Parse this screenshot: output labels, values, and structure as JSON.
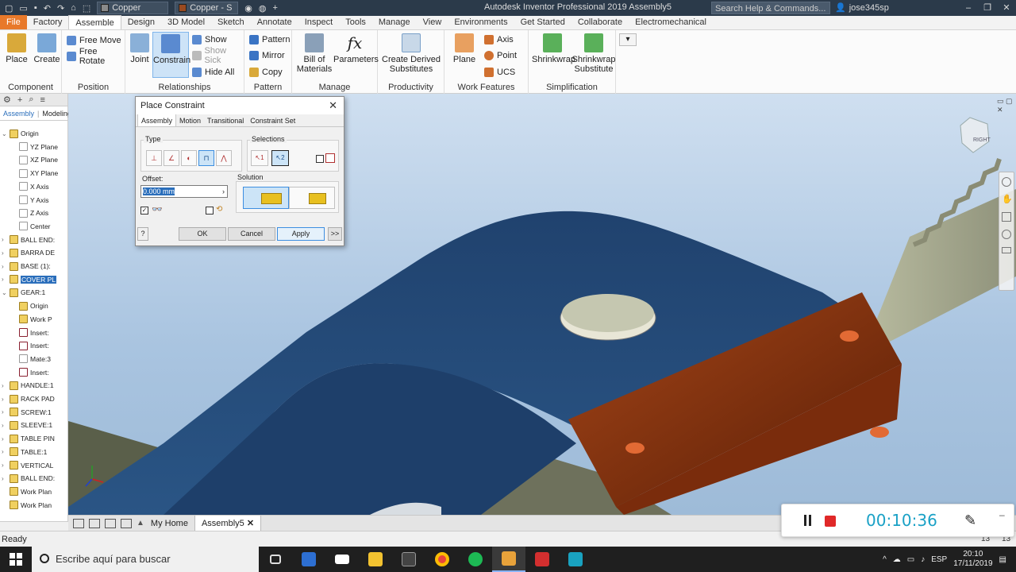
{
  "titlebar": {
    "material": "Copper",
    "appearance": "Copper - S",
    "window_title": "Autodesk Inventor Professional 2019    Assembly5",
    "search_placeholder": "Search Help & Commands...",
    "user": "jose345sp"
  },
  "tabs": [
    "File",
    "Factory",
    "Assemble",
    "Design",
    "3D Model",
    "Sketch",
    "Annotate",
    "Inspect",
    "Tools",
    "Manage",
    "View",
    "Environments",
    "Get Started",
    "Collaborate",
    "Electromechanical"
  ],
  "active_tab": "Assemble",
  "ribbon": {
    "component": {
      "label": "Component",
      "place": "Place",
      "create": "Create"
    },
    "position": {
      "label": "Position",
      "free_move": "Free Move",
      "free_rotate": "Free Rotate"
    },
    "relationships": {
      "label": "Relationships",
      "joint": "Joint",
      "constrain": "Constrain",
      "show": "Show",
      "show_sick": "Show Sick",
      "hide_all": "Hide All"
    },
    "pattern": {
      "label": "Pattern",
      "pattern": "Pattern",
      "mirror": "Mirror",
      "copy": "Copy"
    },
    "manage": {
      "label": "Manage",
      "bom": "Bill of",
      "bom2": "Materials",
      "parameters": "Parameters"
    },
    "productivity": {
      "label": "Productivity",
      "derived": "Create Derived",
      "derived2": "Substitutes"
    },
    "work_features": {
      "label": "Work Features",
      "plane": "Plane",
      "axis": "Axis",
      "point": "Point",
      "ucs": "UCS"
    },
    "simplification": {
      "label": "Simplification",
      "shrinkwrap": "Shrinkwrap",
      "shrinkwrap_sub": "Shrinkwrap",
      "shrinkwrap_sub2": "Substitute"
    }
  },
  "browser": {
    "tabs": [
      "Assembly",
      "Modeling"
    ],
    "nodes": [
      {
        "label": "Origin",
        "kind": "folder",
        "indent": 0,
        "toggle": "−"
      },
      {
        "label": "YZ Plane",
        "kind": "plane",
        "indent": 1
      },
      {
        "label": "XZ Plane",
        "kind": "plane",
        "indent": 1
      },
      {
        "label": "XY Plane",
        "kind": "plane",
        "indent": 1
      },
      {
        "label": "X Axis",
        "kind": "plane",
        "indent": 1
      },
      {
        "label": "Y Axis",
        "kind": "plane",
        "indent": 1
      },
      {
        "label": "Z Axis",
        "kind": "plane",
        "indent": 1
      },
      {
        "label": "Center",
        "kind": "plane",
        "indent": 1
      },
      {
        "label": "BALL END:",
        "kind": "part",
        "indent": 0,
        "toggle": "+"
      },
      {
        "label": "BARRA DE",
        "kind": "part",
        "indent": 0,
        "toggle": "+"
      },
      {
        "label": "BASE (1):",
        "kind": "part",
        "indent": 0,
        "toggle": "+"
      },
      {
        "label": "COVER PL",
        "kind": "part",
        "indent": 0,
        "toggle": "+",
        "selected": true
      },
      {
        "label": "GEAR:1",
        "kind": "part",
        "indent": 0,
        "toggle": "−"
      },
      {
        "label": "Origin",
        "kind": "folder",
        "indent": 1
      },
      {
        "label": "Work P",
        "kind": "folder",
        "indent": 1
      },
      {
        "label": "Insert:",
        "kind": "ins",
        "indent": 1
      },
      {
        "label": "Insert:",
        "kind": "ins",
        "indent": 1
      },
      {
        "label": "Mate:3",
        "kind": "plane",
        "indent": 1
      },
      {
        "label": "Insert:",
        "kind": "ins",
        "indent": 1
      },
      {
        "label": "HANDLE:1",
        "kind": "part",
        "indent": 0,
        "toggle": "+"
      },
      {
        "label": "RACK PAD",
        "kind": "part",
        "indent": 0,
        "toggle": "+"
      },
      {
        "label": "SCREW:1",
        "kind": "part",
        "indent": 0,
        "toggle": "+"
      },
      {
        "label": "SLEEVE:1",
        "kind": "part",
        "indent": 0,
        "toggle": "+"
      },
      {
        "label": "TABLE PIN",
        "kind": "part",
        "indent": 0,
        "toggle": "+"
      },
      {
        "label": "TABLE:1",
        "kind": "part",
        "indent": 0,
        "toggle": "+"
      },
      {
        "label": "VERTICAL",
        "kind": "part",
        "indent": 0,
        "toggle": "+"
      },
      {
        "label": "BALL END:",
        "kind": "part",
        "indent": 0,
        "toggle": "+"
      },
      {
        "label": "Work Plan",
        "kind": "folder",
        "indent": 0
      },
      {
        "label": "Work Plan",
        "kind": "folder",
        "indent": 0
      }
    ]
  },
  "dialog": {
    "title": "Place Constraint",
    "tabs": [
      "Assembly",
      "Motion",
      "Transitional",
      "Constraint Set"
    ],
    "type_label": "Type",
    "selections_label": "Selections",
    "offset_label": "Offset:",
    "offset_value": "0.000 mm",
    "solution_label": "Solution",
    "sel1": "1",
    "sel2": "2",
    "ok": "OK",
    "cancel": "Cancel",
    "apply": "Apply",
    "more": ">>",
    "help": "?"
  },
  "viewcube_label": "RIGHT",
  "doc_tabs": {
    "home": "My Home",
    "doc": "Assembly5"
  },
  "status": {
    "text": "Ready",
    "n1": "13",
    "n2": "13"
  },
  "timer": {
    "elapsed": "00:10:36"
  },
  "taskbar": {
    "search": "Escribe aquí para buscar",
    "lang": "ESP",
    "time": "20:10",
    "date": "17/11/2019"
  }
}
